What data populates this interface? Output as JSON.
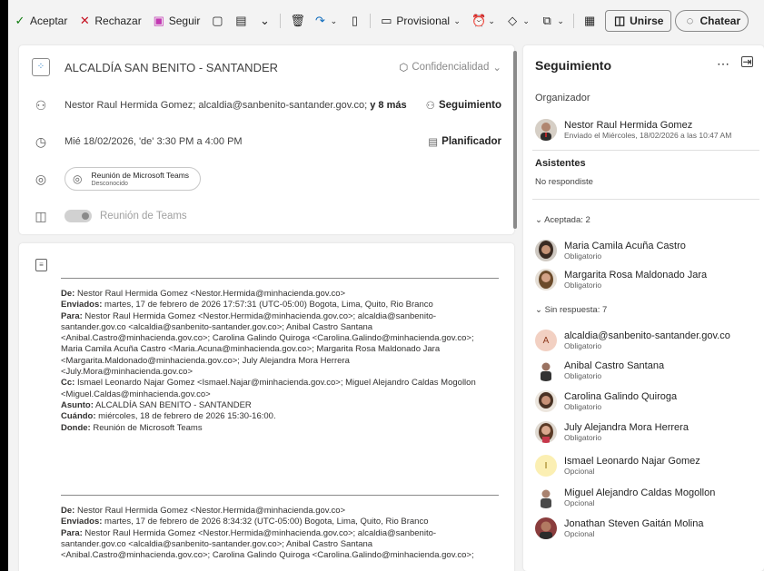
{
  "ribbon": {
    "accept": "Aceptar",
    "decline": "Rechazar",
    "follow": "Seguir",
    "tentative": "Provisional",
    "join": "Unirse",
    "chat": "Chatear"
  },
  "meeting": {
    "title": "ALCALDÍA SAN BENITO - SANTANDER",
    "confidentiality": "Confidencialidad",
    "attendees_text": "Nestor Raul Hermida Gomez; alcaldia@sanbenito-santander.gov.co;",
    "attendees_more": "y 8 más",
    "tracking": "Seguimiento",
    "datetime": "Mié 18/02/2026, 'de' 3:30 PM a 4:00 PM",
    "planner": "Planificador",
    "location_name": "Reunión de Microsoft Teams",
    "location_status": "Desconocido",
    "teams_toggle": "Reunión de Teams"
  },
  "email1": {
    "from_label": "De:",
    "from": "Nestor Raul Hermida Gomez <Nestor.Hermida@minhacienda.gov.co>",
    "sent_label": "Enviados:",
    "sent": "martes, 17 de febrero de 2026 17:57:31 (UTC-05:00) Bogota, Lima, Quito, Rio Branco",
    "to_label": "Para:",
    "to_1": "Nestor Raul Hermida Gomez <Nestor.Hermida@minhacienda.gov.co>; alcaldia@sanbenito-",
    "to_2": "santander.gov.co <alcaldia@sanbenito-santander.gov.co>; Anibal Castro Santana",
    "to_3": "<Anibal.Castro@minhacienda.gov.co>; Carolina Galindo Quiroga <Carolina.Galindo@minhacienda.gov.co>;",
    "to_4": "Maria Camila Acuña Castro <Maria.Acuna@minhacienda.gov.co>; Margarita Rosa Maldonado Jara",
    "to_5": "<Margarita.Maldonado@minhacienda.gov.co>; July Alejandra Mora Herrera",
    "to_6": "<July.Mora@minhacienda.gov.co>",
    "cc_label": "Cc:",
    "cc_1": "Ismael Leonardo Najar Gomez <Ismael.Najar@minhacienda.gov.co>; Miguel Alejandro Caldas Mogollon",
    "cc_2": "<Miguel.Caldas@minhacienda.gov.co>",
    "subject_label": "Asunto:",
    "subject": "ALCALDÍA SAN BENITO - SANTANDER",
    "when_label": "Cuándo:",
    "when": "miércoles, 18 de febrero de 2026 15:30-16:00.",
    "where_label": "Donde:",
    "where": "Reunión de Microsoft Teams"
  },
  "email2": {
    "from_label": "De:",
    "from": "Nestor Raul Hermida Gomez <Nestor.Hermida@minhacienda.gov.co>",
    "sent_label": "Enviados:",
    "sent": "martes, 17 de febrero de 2026 8:34:32 (UTC-05:00) Bogota, Lima, Quito, Rio Branco",
    "to_label": "Para:",
    "to_1": "Nestor Raul Hermida Gomez <Nestor.Hermida@minhacienda.gov.co>; alcaldia@sanbenito-",
    "to_2": "santander.gov.co <alcaldia@sanbenito-santander.gov.co>; Anibal Castro Santana",
    "to_3": "<Anibal.Castro@minhacienda.gov.co>; Carolina Galindo Quiroga <Carolina.Galindo@minhacienda.gov.co>;"
  },
  "panel": {
    "title": "Seguimiento",
    "organizer_label": "Organizador",
    "organizer_name": "Nestor Raul Hermida Gomez",
    "organizer_sent": "Enviado el Miércoles, 18/02/2026 a las 10:47 AM",
    "attendees_label": "Asistentes",
    "no_response": "No respondiste",
    "accepted_label": "Aceptada: 2",
    "noresp_label": "Sin respuesta: 7",
    "people": [
      {
        "name": "Maria Camila Acuña Castro",
        "role": "Obligatorio"
      },
      {
        "name": "Margarita Rosa Maldonado Jara",
        "role": "Obligatorio"
      },
      {
        "name": "alcaldia@sanbenito-santander.gov.co",
        "role": "Obligatorio",
        "initial": "A"
      },
      {
        "name": "Anibal Castro Santana",
        "role": "Obligatorio"
      },
      {
        "name": "Carolina Galindo Quiroga",
        "role": "Obligatorio"
      },
      {
        "name": "July Alejandra Mora Herrera",
        "role": "Obligatorio"
      },
      {
        "name": "Ismael Leonardo Najar Gomez",
        "role": "Opcional",
        "initial": "I"
      },
      {
        "name": "Miguel Alejandro Caldas Mogollon",
        "role": "Opcional"
      },
      {
        "name": "Jonathan Steven Gaitán Molina",
        "role": "Opcional"
      }
    ]
  },
  "colors": {
    "accept": "#107c10",
    "decline": "#c50f1f",
    "follow": "#c239b3",
    "brand": "#0f6cbd"
  }
}
